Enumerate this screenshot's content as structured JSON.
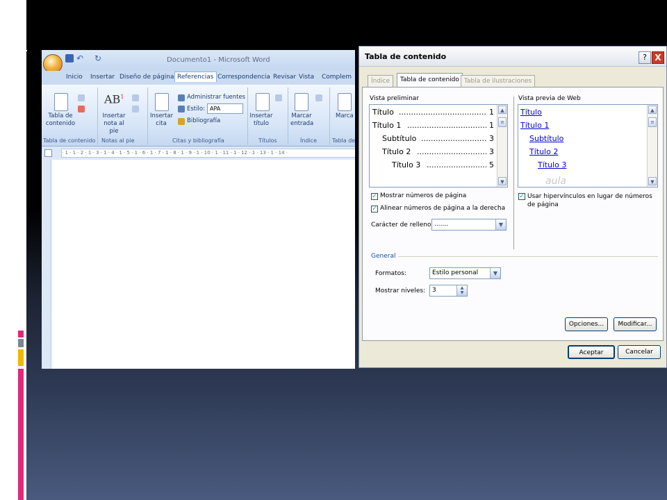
{
  "colors": {
    "accent_pink": "#e0287a",
    "accent_gold": "#f2b700",
    "accent_gray": "#7a8696",
    "link_blue": "#0000cc"
  },
  "word": {
    "title": "Documento1 - Microsoft Word",
    "tabs": [
      "Inicio",
      "Insertar",
      "Diseño de página",
      "Referencias",
      "Correspondencia",
      "Revisar",
      "Vista",
      "Complem"
    ],
    "active_tab": "Referencias",
    "ribbon": {
      "tabla_contenido": "Tabla de contenido",
      "insertar_nota": "Insertar nota al pie",
      "insertar_cita": "Insertar cita",
      "administrar_fuentes": "Administrar fuentes",
      "estilo_label": "Estilo:",
      "estilo_value": "APA",
      "bibliografia": "Bibliografía",
      "insertar_titulo": "Insertar título",
      "marcar_entrada": "Marcar entrada",
      "marca": "Marca",
      "groups": [
        "Tabla de contenido",
        "Notas al pie",
        "Citas y bibliografía",
        "Títulos",
        "Índice",
        "Tabla de"
      ]
    },
    "ruler_text": "· 1 · 1 · 2 · 1 · 3 · 1 · 4 · 1 · 5 · 1 · 6 · 1 · 7 · 1 · 8 · 1 · 9 · 1 · 10 · 1 · 11 · 1 · 12 · 1 · 13 · 1 · 14 ·"
  },
  "dialog": {
    "title": "Tabla de contenido",
    "help_glyph": "?",
    "close_glyph": "X",
    "tabs": [
      "Índice",
      "Tabla de contenido",
      "Tabla de ilustraciones"
    ],
    "active_tab": "Tabla de contenido",
    "print_preview_label": "Vista preliminar",
    "print_preview": [
      {
        "text": "Título",
        "page": "1"
      },
      {
        "text": "Título 1",
        "page": "1"
      },
      {
        "text": "Subtítulo",
        "page": "3"
      },
      {
        "text": "Título 2",
        "page": "3"
      },
      {
        "text": "Título 3",
        "page": "5"
      }
    ],
    "web_preview_label": "Vista previa de Web",
    "web_preview": [
      "Título",
      "Título 1",
      "Subtítulo",
      "Título 2",
      "Título 3"
    ],
    "show_page_numbers": {
      "label": "Mostrar números de página",
      "checked": true
    },
    "right_align": {
      "label": "Alinear números de página a la derecha",
      "checked": true
    },
    "use_hyperlinks": {
      "label": "Usar hipervínculos en lugar de números de página",
      "checked": true
    },
    "fill_char_label": "Carácter de relleno:",
    "fill_char_value": ".......",
    "general_label": "General",
    "formats_label": "Formatos:",
    "formats_value": "Estilo personal",
    "levels_label": "Mostrar niveles:",
    "levels_value": "3",
    "options_button": "Opciones...",
    "modify_button": "Modificar...",
    "ok_button": "Aceptar",
    "cancel_button": "Cancelar",
    "watermark": "aula"
  }
}
